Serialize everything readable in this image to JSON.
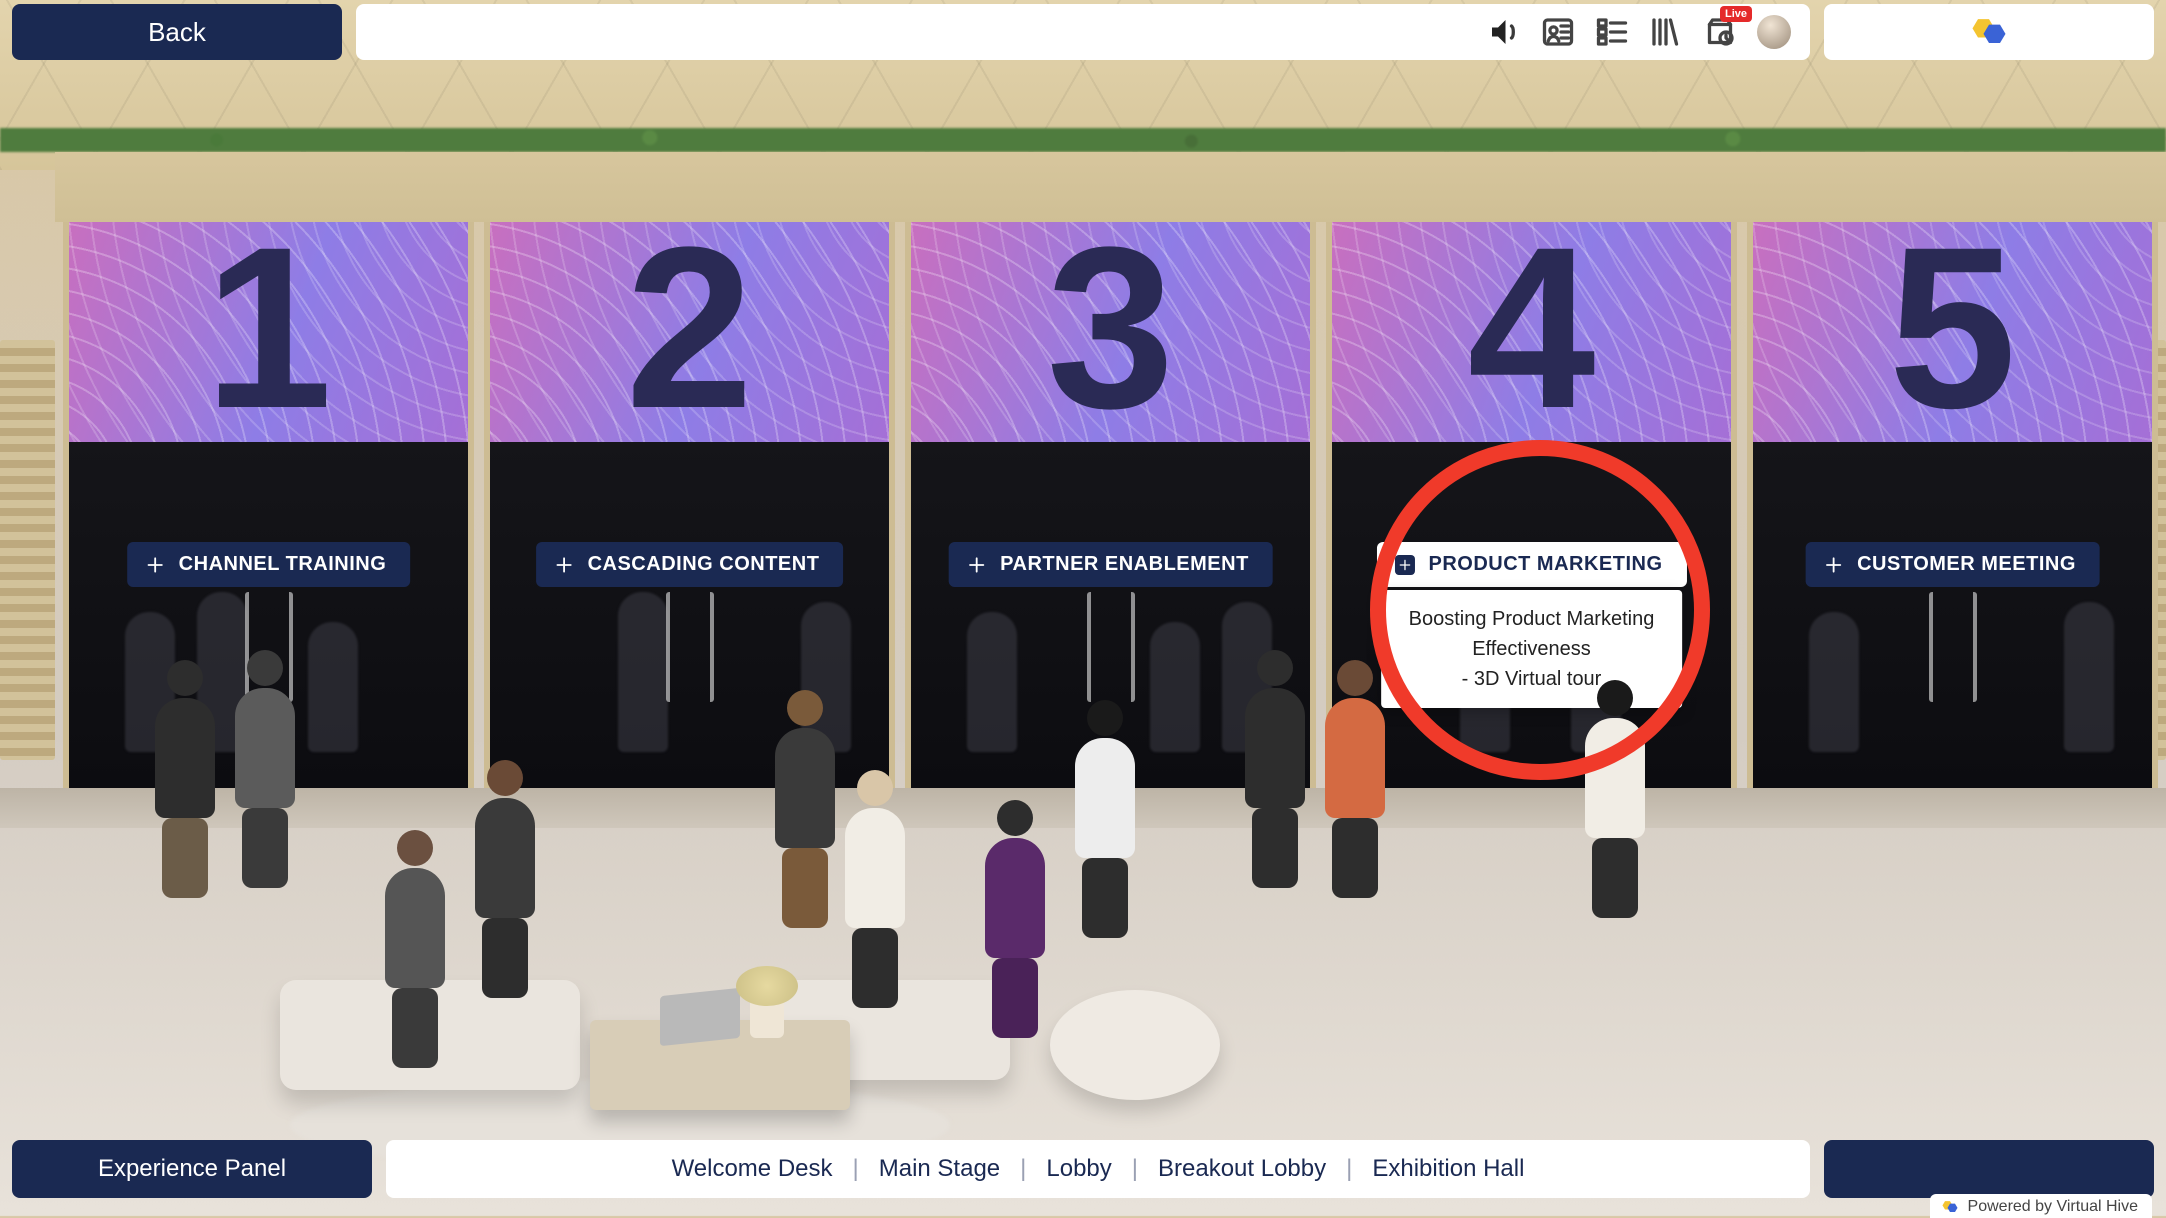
{
  "topbar": {
    "back_label": "Back",
    "search_placeholder": "",
    "live_badge": "Live",
    "icons": {
      "sound": "sound-icon",
      "badge": "badge-icon",
      "list": "list-icon",
      "library": "library-icon",
      "schedule": "schedule-icon",
      "avatar": "avatar-icon"
    }
  },
  "rooms": [
    {
      "number": "1",
      "label": "CHANNEL TRAINING",
      "highlight": false
    },
    {
      "number": "2",
      "label": "CASCADING CONTENT",
      "highlight": false
    },
    {
      "number": "3",
      "label": "PARTNER ENABLEMENT",
      "highlight": false
    },
    {
      "number": "4",
      "label": "PRODUCT MARKETING",
      "highlight": true,
      "tooltip_line1": "Boosting Product Marketing",
      "tooltip_line2": "Effectiveness",
      "tooltip_line3": "- 3D Virtual tour"
    },
    {
      "number": "5",
      "label": "CUSTOMER MEETING",
      "highlight": false
    }
  ],
  "bottombar": {
    "experience_label": "Experience Panel",
    "nav": [
      "Welcome Desk",
      "Main Stage",
      "Lobby",
      "Breakout Lobby",
      "Exhibition Hall"
    ]
  },
  "footer": {
    "powered": "Powered by Virtual Hive"
  },
  "colors": {
    "navy": "#1a2952",
    "accent_red": "#f03a2a",
    "live_red": "#e52a2a"
  }
}
